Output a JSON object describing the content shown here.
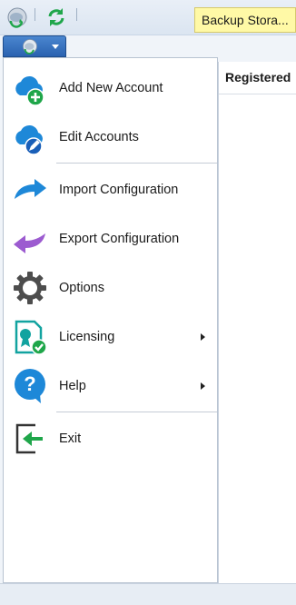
{
  "toolbar": {
    "tooltip_text": "Backup Stora...",
    "icons": [
      "cloud-sync-icon",
      "refresh-icon"
    ]
  },
  "app_menu": {
    "icon": "cloud-sync-icon",
    "caret": "chevron-down-icon"
  },
  "right_panel": {
    "column_header": "Registered"
  },
  "menu": {
    "items": [
      {
        "label": "Add New Account",
        "icon": "cloud-add-icon"
      },
      {
        "label": "Edit Accounts",
        "icon": "cloud-edit-icon"
      },
      {
        "label": "Import Configuration",
        "icon": "import-arrow-icon"
      },
      {
        "label": "Export Configuration",
        "icon": "export-arrow-icon"
      },
      {
        "label": "Options",
        "icon": "gear-icon"
      },
      {
        "label": "Licensing",
        "icon": "license-certificate-icon",
        "has_submenu": true
      },
      {
        "label": "Help",
        "icon": "help-icon",
        "has_submenu": true
      },
      {
        "label": "Exit",
        "icon": "exit-icon"
      }
    ]
  },
  "colors": {
    "accent_blue": "#2a62b0",
    "cloud_blue": "#1e88d8",
    "green": "#1fa64a",
    "purple": "#9c5bd0",
    "tooltip_yellow": "#fff9a6"
  }
}
